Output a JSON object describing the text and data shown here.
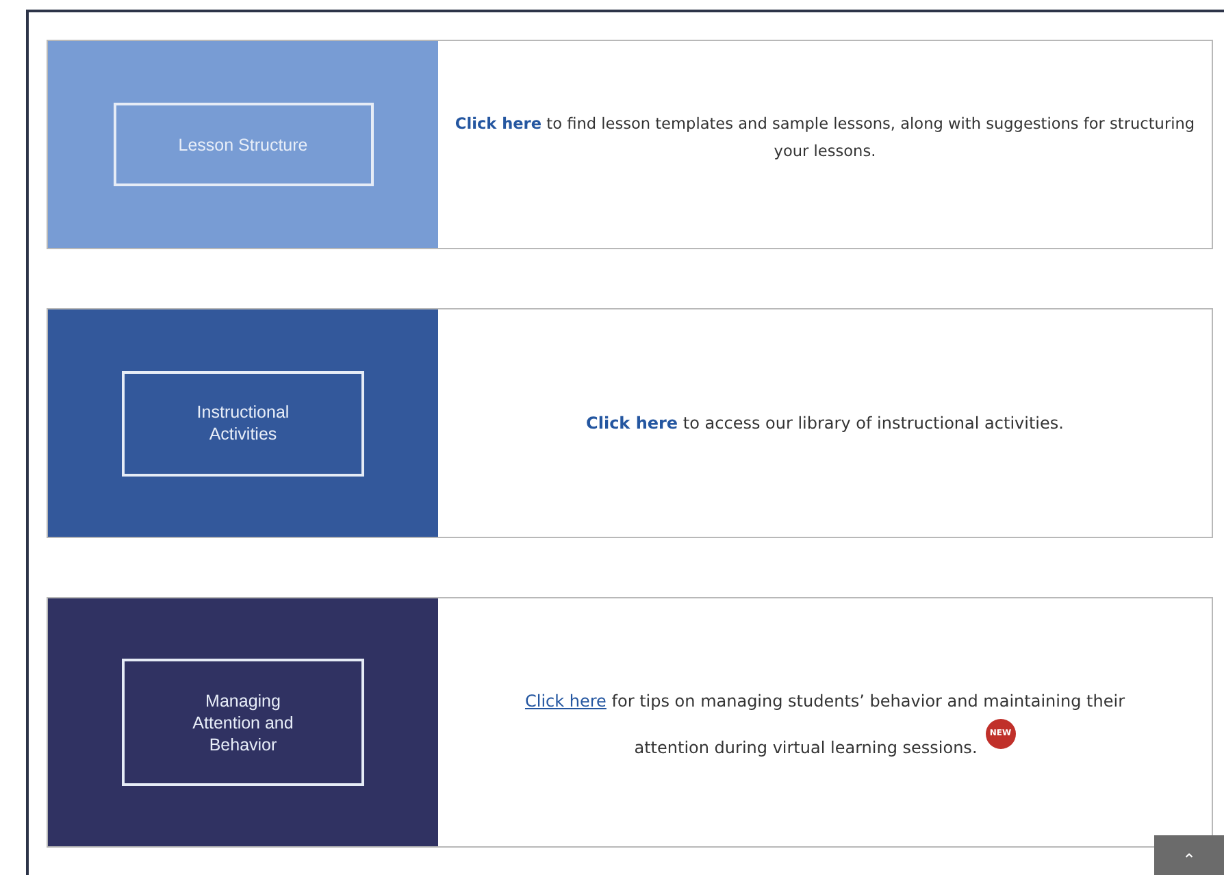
{
  "cards": [
    {
      "title_lines": [
        "Lesson Structure"
      ],
      "color": "#789cd4",
      "link": "Click here",
      "link_underlined": false,
      "text": "to find lesson templates and sample lessons, along with suggestions for structuring your lessons."
    },
    {
      "title_lines": [
        "Instructional",
        "Activities"
      ],
      "color": "#33589b",
      "link": "Click here",
      "link_underlined": false,
      "text": "to access our library of instructional activities."
    },
    {
      "title_lines": [
        "Managing",
        "Attention and",
        "Behavior"
      ],
      "color": "#303262",
      "link": "Click here",
      "link_underlined": true,
      "text": "for tips on managing students’ behavior and maintaining their attention during virtual learning sessions.",
      "badge": "NEW"
    }
  ],
  "scroll_top": {
    "label": "⌃"
  }
}
